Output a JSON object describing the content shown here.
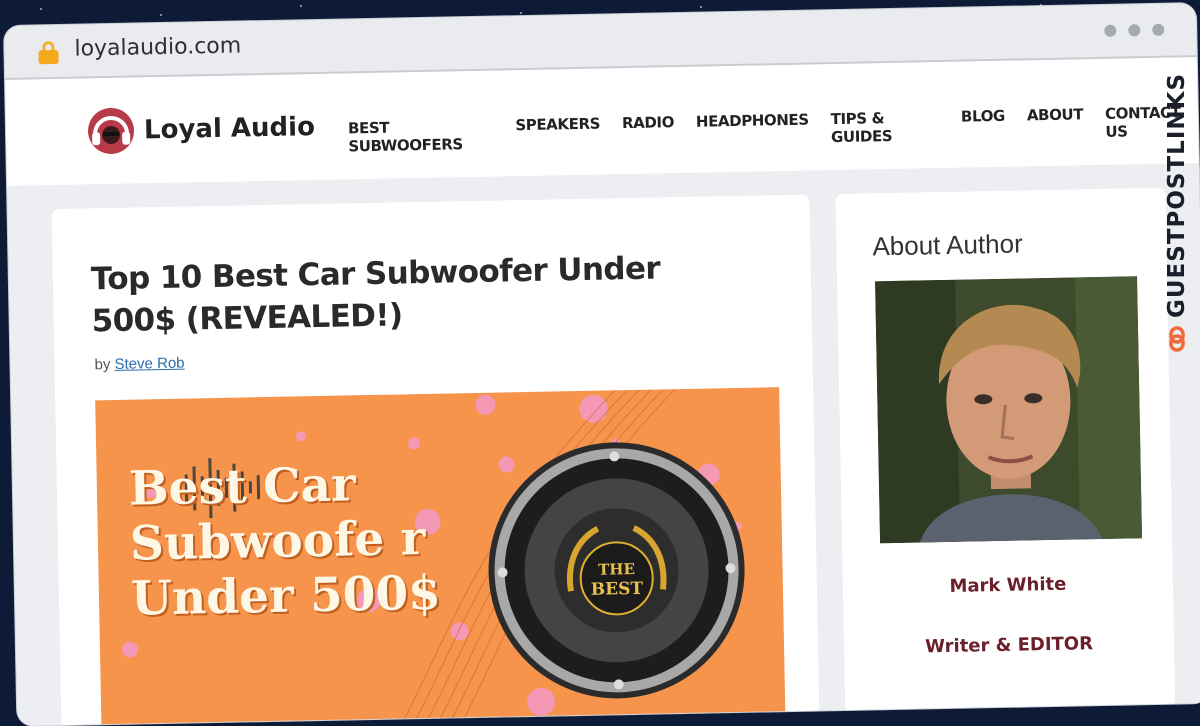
{
  "browser": {
    "url": "loyalaudio.com"
  },
  "site": {
    "logo_text": "Loyal Audio",
    "nav": [
      "BEST SUBWOOFERS",
      "SPEAKERS",
      "RADIO",
      "HEADPHONES",
      "TIPS & GUIDES",
      "BLOG",
      "ABOUT",
      "CONTACT US"
    ]
  },
  "article": {
    "title": "Top 10 Best Car Subwoofer Under 500$ (REVEALED!)",
    "by_label": "by",
    "author_link": "Steve Rob",
    "hero_title": "Best Car Subwoofe r Under 500$",
    "hero_badge_line1": "THE",
    "hero_badge_line2": "BEST"
  },
  "sidebar": {
    "title": "About Author",
    "author_name": "Mark White",
    "author_role": "Writer & EDITOR"
  },
  "watermark": {
    "text": "GUESTPOSTLINKS"
  },
  "colors": {
    "accent": "#f6944c",
    "author": "#6a1f2b",
    "link": "#2a6fb0"
  }
}
